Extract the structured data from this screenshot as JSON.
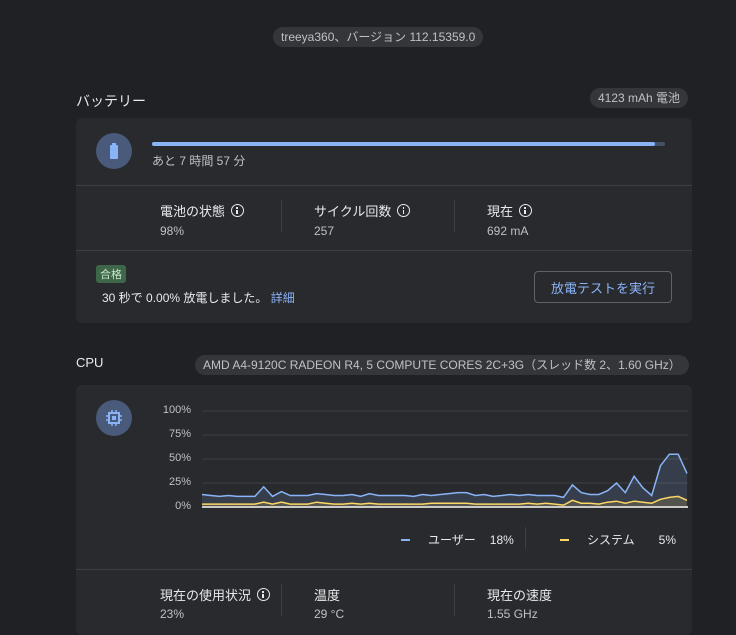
{
  "header": {
    "version_pill": "treeya360、バージョン 112.15359.0"
  },
  "battery": {
    "title": "バッテリー",
    "capacity_pill": "4123 mAh 電池",
    "icon": "battery-icon",
    "charge_percent": 98,
    "time_remaining": "あと 7 時間 57 分",
    "stats": [
      {
        "label": "電池の状態",
        "value": "98%",
        "has_info": true
      },
      {
        "label": "サイクル回数",
        "value": "257",
        "has_info": true
      },
      {
        "label": "現在",
        "value": "692 mA",
        "has_info": true
      }
    ],
    "test": {
      "badge": "合格",
      "result_text": "30 秒で 0.00% 放電しました。",
      "details_link": "詳細",
      "run_button": "放電テストを実行"
    }
  },
  "cpu": {
    "title": "CPU",
    "model_pill": "AMD A4-9120C RADEON R4, 5 COMPUTE CORES 2C+3G（スレッド数 2、1.60 GHz）",
    "icon": "cpu-chip-icon",
    "legend": [
      {
        "label": "ユーザー",
        "value": "18%",
        "color": "#8ab4f8"
      },
      {
        "label": "システム",
        "value": "5%",
        "color": "#fdd663"
      }
    ],
    "stats": [
      {
        "label": "現在の使用状況",
        "value": "23%",
        "has_info": true
      },
      {
        "label": "温度",
        "value": "29 °C",
        "has_info": false
      },
      {
        "label": "現在の速度",
        "value": "1.55 GHz",
        "has_info": false
      }
    ]
  },
  "chart_data": {
    "type": "area",
    "title": "",
    "xlabel": "",
    "ylabel": "",
    "ylim": [
      0,
      100
    ],
    "yticks": [
      "100%",
      "75%",
      "50%",
      "25%",
      "0%"
    ],
    "ytick_values": [
      100,
      75,
      50,
      25,
      0
    ],
    "grid": true,
    "legend_position": "bottom-right",
    "series": [
      {
        "name": "ユーザー",
        "color": "#8ab4f8",
        "values": [
          13,
          12,
          11,
          12,
          11,
          11,
          11,
          21,
          11,
          16,
          12,
          12,
          12,
          14,
          13,
          12,
          12,
          13,
          11,
          14,
          12,
          12,
          12,
          12,
          11,
          13,
          12,
          13,
          14,
          15,
          15,
          12,
          13,
          11,
          12,
          13,
          12,
          13,
          12,
          12,
          12,
          10,
          23,
          15,
          13,
          13,
          17,
          25,
          15,
          32,
          20,
          12,
          43,
          55,
          55,
          35
        ]
      },
      {
        "name": "システム",
        "color": "#fdd663",
        "values": [
          3,
          3,
          3,
          3,
          3,
          3,
          3,
          5,
          3,
          5,
          3,
          3,
          3,
          5,
          4,
          3,
          3,
          4,
          3,
          4,
          3,
          3,
          3,
          3,
          3,
          3,
          4,
          4,
          4,
          4,
          4,
          3,
          3,
          3,
          3,
          3,
          3,
          4,
          3,
          4,
          3,
          2,
          7,
          4,
          4,
          3,
          5,
          6,
          4,
          6,
          5,
          4,
          8,
          10,
          11,
          7
        ]
      }
    ]
  }
}
